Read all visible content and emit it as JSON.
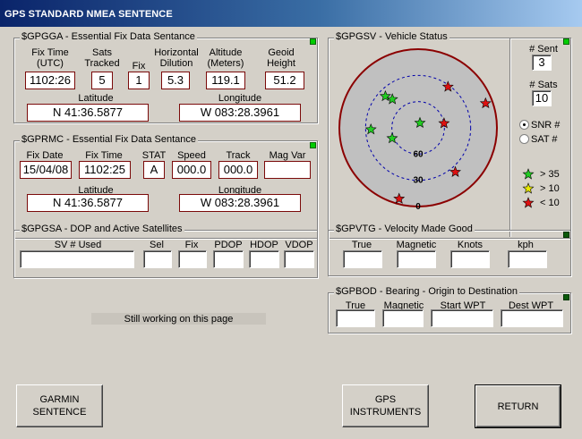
{
  "window": {
    "title": "GPS STANDARD NMEA SENTENCE"
  },
  "gga": {
    "title": "$GPGGA - Essential Fix Data Sentance",
    "labels": {
      "fix_time": "Fix Time\n(UTC)",
      "sats_tracked": "Sats\nTracked",
      "fix": "Fix",
      "hdop": "Horizontal\nDilution",
      "altitude": "Altitude\n(Meters)",
      "geoid": "Geoid\nHeight",
      "latitude": "Latitude",
      "longitude": "Longitude"
    },
    "values": {
      "fix_time": "1102:26",
      "sats_tracked": "5",
      "fix": "1",
      "hdop": "5.3",
      "altitude": "119.1",
      "geoid": "51.2",
      "latitude": "N 41:36.5877",
      "longitude": "W 083:28.3961"
    }
  },
  "rmc": {
    "title": "$GPRMC - Essential Fix Data Sentance",
    "labels": {
      "fix_date": "Fix Date",
      "fix_time": "Fix Time",
      "stat": "STAT",
      "speed": "Speed",
      "track": "Track",
      "mag_var": "Mag Var",
      "latitude": "Latitude",
      "longitude": "Longitude"
    },
    "values": {
      "fix_date": "15/04/08",
      "fix_time": "1102:25",
      "stat": "A",
      "speed": "000.0",
      "track": "000.0",
      "mag_var": "",
      "latitude": "N 41:36.5877",
      "longitude": "W 083:28.3961"
    }
  },
  "gsa": {
    "title": "$GPGSA - DOP and Active Satellites",
    "labels": {
      "sv_used": "SV # Used",
      "sel": "Sel",
      "fix": "Fix",
      "pdop": "PDOP",
      "hdop": "HDOP",
      "vdop": "VDOP"
    },
    "values": {
      "sv_used": "",
      "sel": "",
      "fix": "",
      "pdop": "",
      "hdop": "",
      "vdop": ""
    }
  },
  "gsv": {
    "title": "$GPGSV - Vehicle Status",
    "labels": {
      "sent": "# Sent",
      "sats": "# Sats",
      "snr": "SNR #",
      "sat": "SAT #"
    },
    "values": {
      "sent": "3",
      "sats": "10"
    },
    "selected_mode": "SNR #",
    "elevation_labels": [
      "60",
      "30",
      "0"
    ],
    "legend": [
      {
        "label": "> 35",
        "color": "#22cc22"
      },
      {
        "label": "> 10",
        "color": "#e8e800"
      },
      {
        "label": "< 10",
        "color": "#dd1111"
      }
    ],
    "satellites": [
      {
        "el": 38,
        "az": 314,
        "color": "#22cc22"
      },
      {
        "el": 46,
        "az": 318,
        "color": "#22cc22"
      },
      {
        "el": 84,
        "az": 20,
        "color": "#22cc22"
      },
      {
        "el": 36,
        "az": 268,
        "color": "#22cc22"
      },
      {
        "el": 58,
        "az": 248,
        "color": "#22cc22"
      },
      {
        "el": 32,
        "az": 36,
        "color": "#dd1111"
      },
      {
        "el": 8,
        "az": 70,
        "color": "#dd1111"
      },
      {
        "el": 60,
        "az": 80,
        "color": "#dd1111"
      },
      {
        "el": 24,
        "az": 140,
        "color": "#dd1111"
      },
      {
        "el": 6,
        "az": 195,
        "color": "#dd1111"
      }
    ]
  },
  "vtg": {
    "title": "$GPVTG - Velocity Made Good",
    "labels": {
      "true": "True",
      "magnetic": "Magnetic",
      "knots": "Knots",
      "kph": "kph"
    },
    "values": {
      "true": "",
      "magnetic": "",
      "knots": "",
      "kph": ""
    }
  },
  "bod": {
    "title": "$GPBOD - Bearing - Origin to Destination",
    "labels": {
      "true": "True",
      "magnetic": "Magnetic",
      "start_wpt": "Start WPT",
      "dest_wpt": "Dest WPT"
    },
    "values": {
      "true": "",
      "magnetic": "",
      "start_wpt": "",
      "dest_wpt": ""
    }
  },
  "status": {
    "text": "Still working on this page"
  },
  "buttons": {
    "garmin": "GARMIN\nSENTENCE",
    "gps_instruments": "GPS\nINSTRUMENTS",
    "return": "RETURN"
  },
  "colors": {
    "led_green": "#00cc00",
    "led_dark": "#0a5a0a",
    "radar_ring": "#8b0000",
    "radar_fill": "#c0c0c0",
    "grid_dash": "#0000aa"
  }
}
